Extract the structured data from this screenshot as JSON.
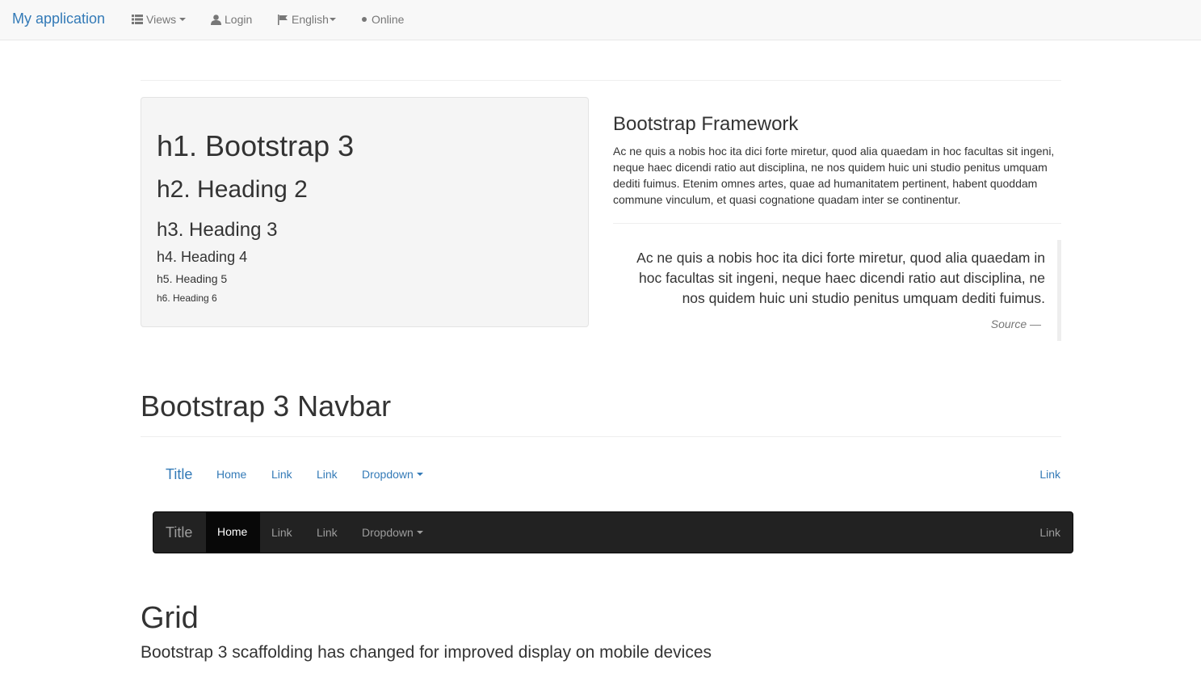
{
  "topbar": {
    "brand": "My application",
    "views_label": "Views",
    "login_label": "Login",
    "language_label": "English",
    "status_label": "Online"
  },
  "headings_well": {
    "h1": "h1. Bootstrap 3",
    "h2": "h2. Heading 2",
    "h3": "h3. Heading 3",
    "h4": "h4. Heading 4",
    "h5": "h5. Heading 5",
    "h6": "h6. Heading 6"
  },
  "framework": {
    "title": "Bootstrap Framework",
    "text": "Ac ne quis a nobis hoc ita dici forte miretur, quod alia quaedam in hoc facultas sit ingeni, neque haec dicendi ratio aut disciplina, ne nos quidem huic uni studio penitus umquam dediti fuimus. Etenim omnes artes, quae ad humanitatem pertinent, habent quoddam commune vinculum, et quasi cognatione quadam inter se continentur."
  },
  "blockquote": {
    "text": "Ac ne quis a nobis hoc ita dici forte miretur, quod alia quaedam in hoc facultas sit ingeni, neque haec dicendi ratio aut disciplina, ne nos quidem huic uni studio penitus umquam dediti fuimus.",
    "source": "Source —"
  },
  "navbar_section": {
    "title": "Bootstrap 3 Navbar",
    "default_nav": {
      "title": "Title",
      "items": [
        "Home",
        "Link",
        "Link"
      ],
      "dropdown": "Dropdown",
      "right_link": "Link"
    },
    "inverse_nav": {
      "title": "Title",
      "active": "Home",
      "items": [
        "Link",
        "Link"
      ],
      "dropdown": "Dropdown",
      "right_link": "Link"
    }
  },
  "grid_section": {
    "title": "Grid",
    "lead": "Bootstrap 3 scaffolding has changed for improved display on mobile devices"
  },
  "colors": {
    "link": "#337ab7",
    "navbar_inverse_bg": "#222222",
    "well_bg": "#f5f5f5"
  }
}
